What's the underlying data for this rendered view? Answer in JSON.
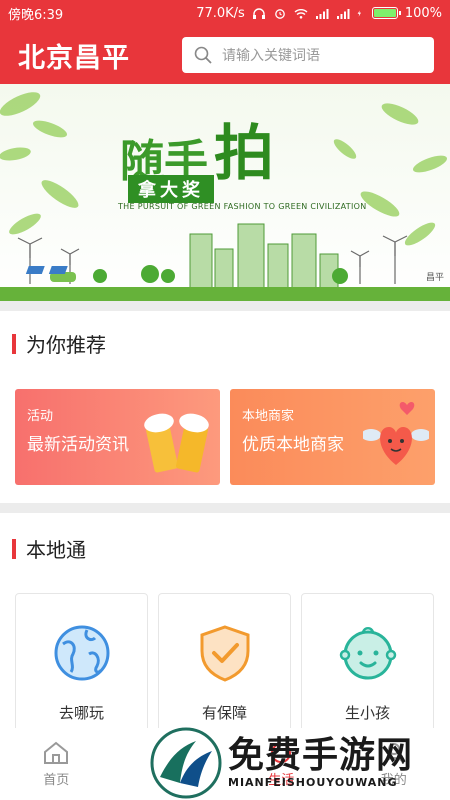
{
  "status_bar": {
    "time": "傍晚6:39",
    "speed": "77.0K/s",
    "battery": "100%",
    "battery_level": 1.0
  },
  "header": {
    "logo": "北京昌平",
    "search_placeholder": "请输入关键词语"
  },
  "banner": {
    "title_chars": "随手",
    "title_big": "拍",
    "subtitle": "拿大奖",
    "english": "THE PURSUIT OF GREEN FASHION TO GREEN CIVILIZATION",
    "corner_text": "昌平"
  },
  "recommend": {
    "title": "为你推荐",
    "cards": [
      {
        "tag": "活动",
        "title": "最新活动资讯"
      },
      {
        "tag": "本地商家",
        "title": "优质本地商家"
      }
    ]
  },
  "local": {
    "title": "本地通",
    "items": [
      {
        "label": "去哪玩",
        "icon": "globe-icon"
      },
      {
        "label": "有保障",
        "icon": "shield-check-icon"
      },
      {
        "label": "生小孩",
        "icon": "baby-face-icon"
      }
    ]
  },
  "tabbar": {
    "items": [
      "首页",
      "",
      "生活",
      "我的"
    ]
  },
  "watermark": {
    "big": "免费手游网",
    "small": "MIANFEISHOUYOUWANG"
  },
  "colors": {
    "brand": "#e8363b",
    "green": "#3b9a2a"
  }
}
